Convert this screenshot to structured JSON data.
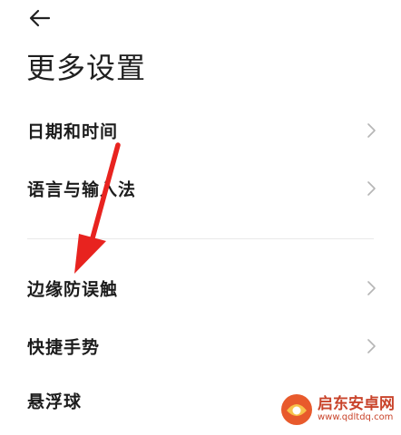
{
  "header": {
    "back_icon": "arrow-left-icon",
    "title": "更多设置"
  },
  "settings": {
    "items": [
      {
        "label": "日期和时间",
        "icon": "chevron-right-icon"
      },
      {
        "label": "语言与输入法",
        "icon": "chevron-right-icon"
      },
      {
        "label": "边缘防误触",
        "icon": "chevron-right-icon"
      },
      {
        "label": "快捷手势",
        "icon": "chevron-right-icon"
      },
      {
        "label": "悬浮球",
        "icon": "chevron-right-icon"
      }
    ]
  },
  "annotation": {
    "arrow_color": "#e8231f"
  },
  "watermark": {
    "name": "启东安卓网",
    "url": "www.qdltdq.com"
  },
  "colors": {
    "text": "#1c1c1c",
    "chevron": "#b5b5b5",
    "divider": "#e9e9e9",
    "watermark": "#c9442b"
  }
}
